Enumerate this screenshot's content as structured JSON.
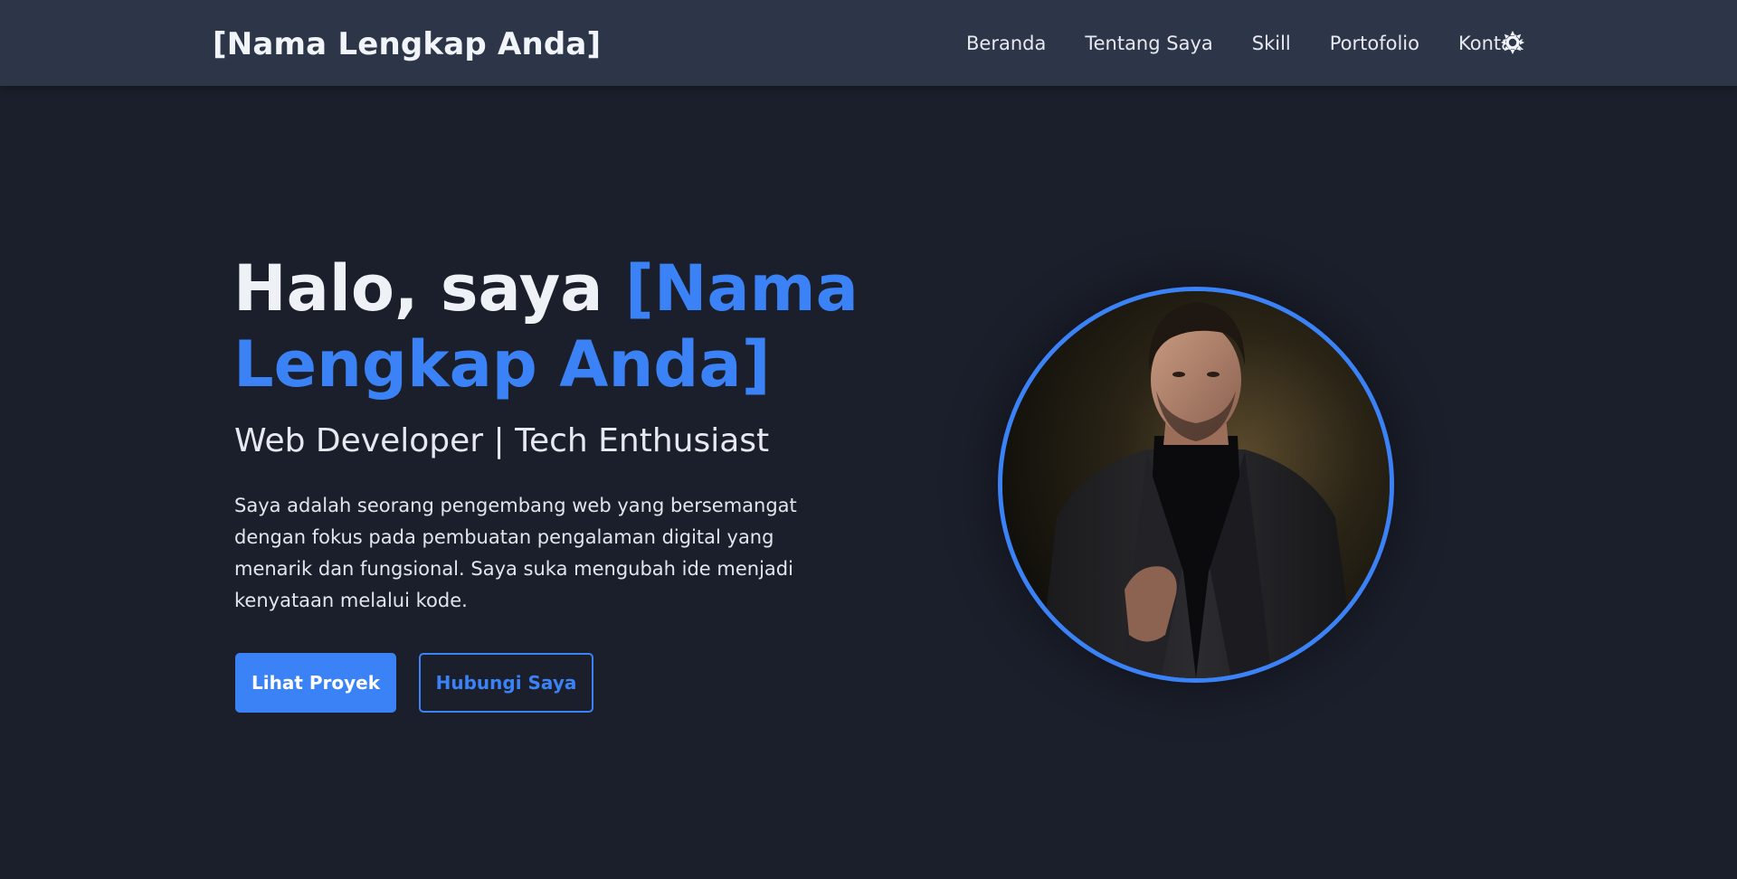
{
  "navbar": {
    "brand": "[Nama Lengkap Anda]",
    "links": [
      "Beranda",
      "Tentang Saya",
      "Skill",
      "Portofolio",
      "Kontak"
    ],
    "theme_toggle_icon": "sun-icon"
  },
  "hero": {
    "title_prefix": "Halo, saya ",
    "title_name": "[Nama Lengkap Anda]",
    "subtitle": "Web Developer | Tech Enthusiast",
    "description": "Saya adalah seorang pengembang web yang bersemangat dengan fokus pada pembuatan pengalaman digital yang menarik dan fungsional. Saya suka mengubah ide menjadi kenyataan melalui kode.",
    "primary_button": "Lihat Proyek",
    "secondary_button": "Hubungi Saya",
    "portrait_icon": "profile-photo"
  },
  "colors": {
    "accent": "#3b82f6",
    "background": "#1b1f2b",
    "navbar": "#2d3648"
  }
}
